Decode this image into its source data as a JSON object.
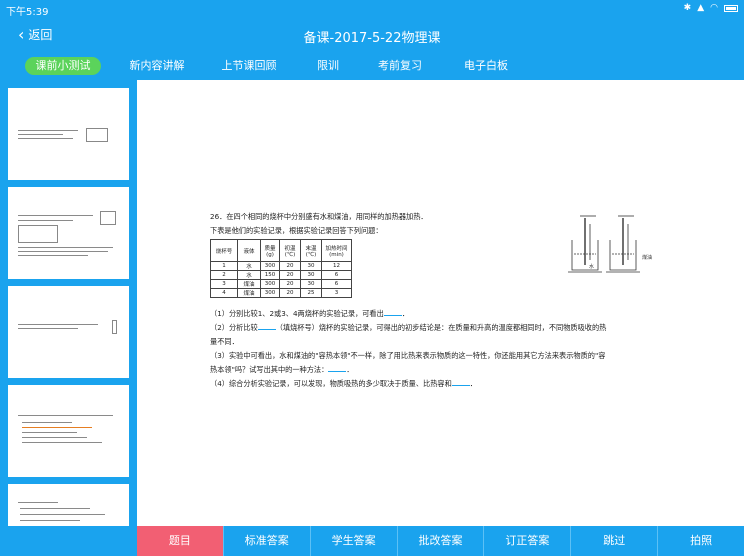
{
  "status": {
    "time": "下午5:39"
  },
  "header": {
    "back_label": "返回",
    "title": "备课-2017-5-22物理课"
  },
  "tabs": [
    {
      "label": "课前小测试",
      "active": true
    },
    {
      "label": "新内容讲解"
    },
    {
      "label": "上节课回顾"
    },
    {
      "label": "限训"
    },
    {
      "label": "考前复习"
    },
    {
      "label": "电子白板"
    }
  ],
  "question": {
    "line1": "26．在四个相同的烧杯中分别盛有水和煤油，用同样的加热器加热．",
    "line2": "下表是他们的实验记录，根据实验记录回答下列问题：",
    "table_header": [
      "烧杯号",
      "液体",
      "质量\n(g)",
      "初温\n(℃)",
      "末温\n(℃)",
      "加热时间\n(min)"
    ],
    "table_rows": [
      [
        "1",
        "水",
        "300",
        "20",
        "30",
        "12"
      ],
      [
        "2",
        "水",
        "150",
        "20",
        "30",
        "6"
      ],
      [
        "3",
        "煤油",
        "300",
        "20",
        "30",
        "6"
      ],
      [
        "4",
        "煤油",
        "300",
        "20",
        "25",
        "3"
      ]
    ],
    "figure_label_left": "水",
    "figure_label_right": "煤油",
    "q1": "（1）分别比较1、2或3、4两烧杯的实验记录，可看出",
    "q2a": "（2）分析比较",
    "q2b": "（填烧杯号）烧杯的实验记录，可得出的初步结论是：在质量和升高的温度都相同时，不同物质吸收的热",
    "q2c": "量不同．",
    "q3a": "（3）实验中可看出，水和煤油的\"容热本领\"不一样，除了用比热来表示物质的这一特性，你还能用其它方法来表示物质的\"容",
    "q3b": "热本领\"吗？试写出其中的一种方法：",
    "q4": "（4）综合分析实验记录，可以发现，物质吸热的多少取决于质量、比热容和"
  },
  "bottom_buttons": [
    {
      "label": "题目",
      "active": true
    },
    {
      "label": "标准答案"
    },
    {
      "label": "学生答案"
    },
    {
      "label": "批改答案"
    },
    {
      "label": "订正答案"
    },
    {
      "label": "跳过"
    },
    {
      "label": "拍照"
    }
  ],
  "colors": {
    "primary": "#1aa3ee",
    "active_tab": "#5bd35b",
    "active_button": "#f25f73"
  }
}
